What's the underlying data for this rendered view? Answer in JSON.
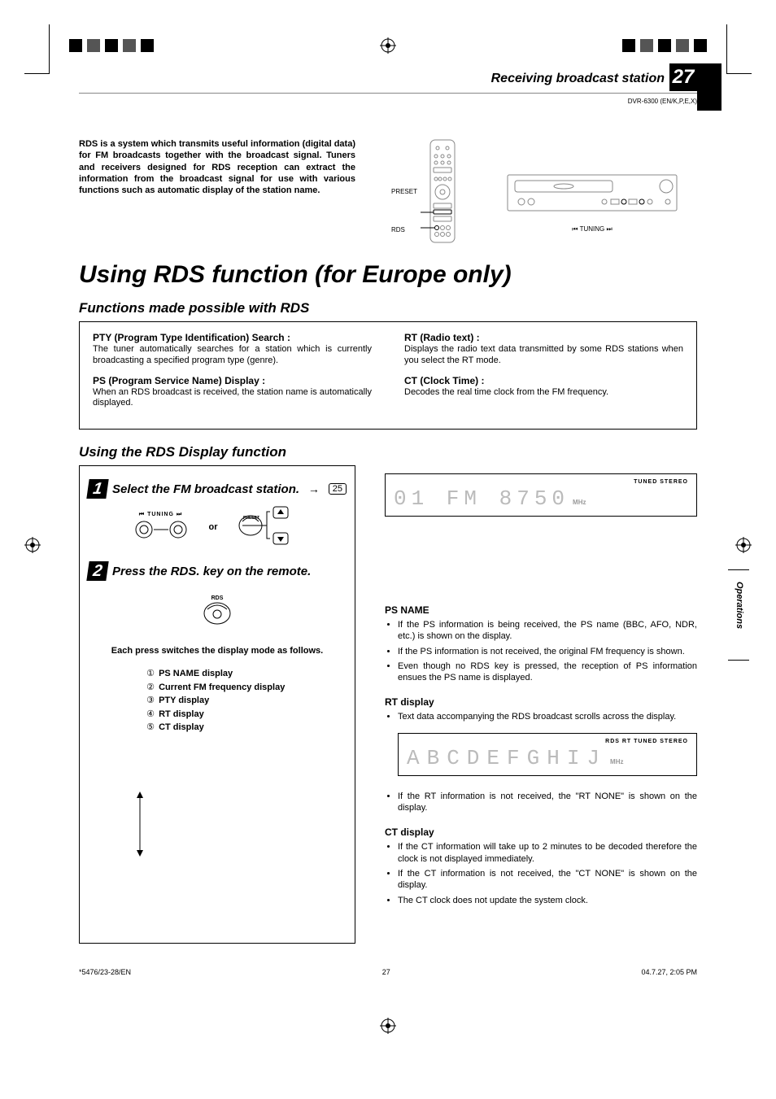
{
  "header": {
    "section_title": "Receiving broadcast station",
    "page_number": "27",
    "model": "DVR-6300 (EN/K,P,E,X)"
  },
  "intro": "RDS is a system which transmits useful information (digital data) for FM broadcasts together with the broadcast signal. Tuners and receivers designed for RDS reception can extract the information from the broadcast signal for use with various functions such as automatic display of the station name.",
  "diagram_labels": {
    "preset": "PRESET",
    "rds": "RDS",
    "tuning": "TUNING",
    "tuning_prev": "⏮",
    "tuning_next": "⏭"
  },
  "main_heading": "Using RDS function (for Europe only)",
  "functions": {
    "heading": "Functions made possible with RDS",
    "left": [
      {
        "title": "PTY (Program Type Identification) Search :",
        "desc": "The tuner automatically searches for a station which is currently broadcasting a specified program type (genre)."
      },
      {
        "title": "PS (Program Service Name) Display :",
        "desc": "When an RDS broadcast is received, the station name is automatically displayed."
      }
    ],
    "right": [
      {
        "title": "RT (Radio text) :",
        "desc": "Displays the radio text data transmitted by some RDS stations when you select the RT mode."
      },
      {
        "title": "CT (Clock Time) :",
        "desc": "Decodes the real time clock from the FM frequency."
      }
    ]
  },
  "rds_display": {
    "heading": "Using the RDS Display function",
    "step1": {
      "num": "1",
      "title": "Select the FM broadcast station.",
      "page_ref": "25",
      "or": "or",
      "tuning_label": "⏮ TUNING ⏭",
      "preset_label": "PRESET"
    },
    "step2": {
      "num": "2",
      "title": "Press the RDS. key on the remote.",
      "rds_label": "RDS",
      "note": "Each press switches the display mode as follows.",
      "modes": [
        {
          "n": "①",
          "label": "PS NAME display"
        },
        {
          "n": "②",
          "label": "Current FM  frequency display"
        },
        {
          "n": "③",
          "label": "PTY display"
        },
        {
          "n": "④",
          "label": "RT display"
        },
        {
          "n": "⑤",
          "label": "CT display"
        }
      ]
    }
  },
  "lcd": {
    "ind1": "TUNED  STEREO",
    "line1": "01  FM  8750",
    "unit1": "MHz",
    "ind2": "RDS   RT            TUNED  STEREO",
    "line2": "ABCDEFGHIJ",
    "unit2": "MHz"
  },
  "right_sections": {
    "ps_name_title": "PS NAME",
    "ps_name_items": [
      "If the PS information is being received, the PS name (BBC, AFO, NDR, etc.) is shown on the display.",
      "If the PS information is not received, the original FM frequency is shown.",
      "Even though no RDS key is pressed, the reception of PS information ensues the PS name is displayed."
    ],
    "rt_title": "RT display",
    "rt_items_a": [
      "Text data accompanying the RDS broadcast scrolls across the display."
    ],
    "rt_items_b": [
      "If the RT information is not received, the \"RT NONE\" is shown on the display."
    ],
    "ct_title": "CT display",
    "ct_items": [
      "If the CT information will take up to 2 minutes to be decoded therefore the clock is not displayed immediately.",
      "If the CT information is not received, the \"CT NONE\" is shown on the display.",
      "The CT clock does not update the system clock."
    ]
  },
  "side_tab": "Operations",
  "footer": {
    "left": "*5476/23-28/EN",
    "center": "27",
    "right": "04.7.27, 2:05 PM"
  }
}
